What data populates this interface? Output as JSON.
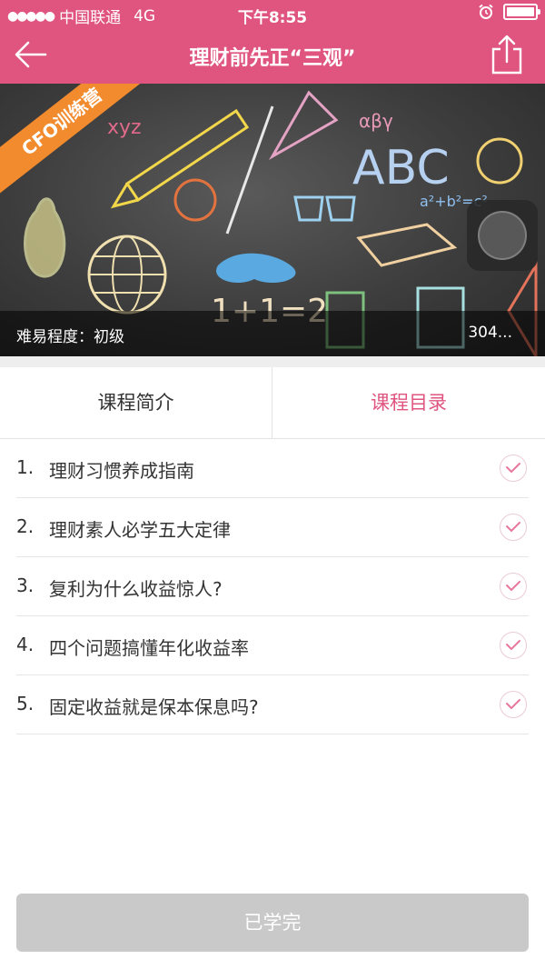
{
  "status_bar": {
    "carrier": "中国联通",
    "network": "4G",
    "time": "下午8:55",
    "signal_icon": "signal-dots-icon",
    "alarm_icon": "alarm-icon",
    "battery_icon": "battery-icon"
  },
  "nav": {
    "title": "理财前先正“三观”",
    "back_icon": "back-arrow-icon",
    "share_icon": "share-icon"
  },
  "banner": {
    "ribbon_text": "CFO训练营",
    "difficulty_label": "难易程度：初级",
    "count_text": "304..."
  },
  "tabs": {
    "intro": "课程简介",
    "catalog": "课程目录"
  },
  "lessons": [
    {
      "num": "1.",
      "title": "理财习惯养成指南"
    },
    {
      "num": "2.",
      "title": "理财素人必学五大定律"
    },
    {
      "num": "3.",
      "title": "复利为什么收益惊人?"
    },
    {
      "num": "4.",
      "title": "四个问题搞懂年化收益率"
    },
    {
      "num": "5.",
      "title": "固定收益就是保本保息吗?"
    }
  ],
  "button": {
    "done_label": "已学完"
  },
  "colors": {
    "brand": "#e05580",
    "accent_ribbon": "#f28a2e",
    "disabled_button": "#c9c9c9"
  }
}
